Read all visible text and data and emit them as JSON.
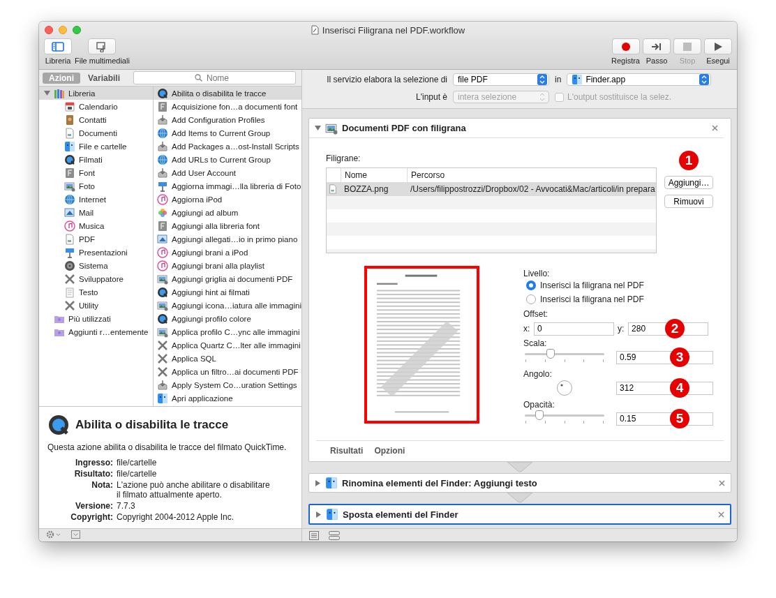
{
  "window": {
    "title": "Inserisci Filigrana nel PDF.workflow"
  },
  "toolbar_left": [
    {
      "label": "Libreria",
      "kind": "library",
      "selected": true
    },
    {
      "label": "File multimediali",
      "kind": "media",
      "selected": false
    }
  ],
  "toolbar_right": [
    {
      "label": "Registra",
      "kind": "record",
      "disabled": false
    },
    {
      "label": "Passo",
      "kind": "step",
      "disabled": false
    },
    {
      "label": "Stop",
      "kind": "stop",
      "disabled": true
    },
    {
      "label": "Esegui",
      "kind": "run",
      "disabled": false
    }
  ],
  "library_tabs": [
    {
      "label": "Azioni",
      "selected": true
    },
    {
      "label": "Variabili",
      "selected": false
    }
  ],
  "search": {
    "placeholder": "Nome"
  },
  "categories": [
    {
      "label": "Libreria",
      "kind": "library",
      "selected": true,
      "expanded": true,
      "children": [
        {
          "label": "Calendario",
          "kind": "calendar",
          "selected": false
        },
        {
          "label": "Contatti",
          "kind": "contacts",
          "selected": false
        },
        {
          "label": "Documenti",
          "kind": "document",
          "selected": false
        },
        {
          "label": "File e cartelle",
          "kind": "finder",
          "selected": false
        },
        {
          "label": "Filmati",
          "kind": "quicktime",
          "selected": false
        },
        {
          "label": "Font",
          "kind": "font",
          "selected": false
        },
        {
          "label": "Foto",
          "kind": "preview",
          "selected": false
        },
        {
          "label": "Internet",
          "kind": "globe",
          "selected": false
        },
        {
          "label": "Mail",
          "kind": "mail",
          "selected": false
        },
        {
          "label": "Musica",
          "kind": "music",
          "selected": false
        },
        {
          "label": "PDF",
          "kind": "document",
          "selected": false
        },
        {
          "label": "Presentazioni",
          "kind": "keynote",
          "selected": false
        },
        {
          "label": "Sistema",
          "kind": "system",
          "selected": false
        },
        {
          "label": "Sviluppatore",
          "kind": "tools",
          "selected": false
        },
        {
          "label": "Testo",
          "kind": "text",
          "selected": false
        },
        {
          "label": "Utility",
          "kind": "tools",
          "selected": false
        }
      ]
    },
    {
      "label": "Più utilizzati",
      "kind": "smartfolder",
      "selected": false
    },
    {
      "label": "Aggiunti r…entemente",
      "kind": "smartfolder",
      "selected": false
    }
  ],
  "actions": [
    {
      "label": "Abilita o disabilita le tracce",
      "kind": "quicktime",
      "selected": true
    },
    {
      "label": "Acquisizione fon…a documenti font",
      "kind": "font",
      "selected": false
    },
    {
      "label": "Add Configuration Profiles",
      "kind": "installer",
      "selected": false
    },
    {
      "label": "Add Items to Current Group",
      "kind": "globe",
      "selected": false
    },
    {
      "label": "Add Packages a…ost-Install Scripts",
      "kind": "installer",
      "selected": false
    },
    {
      "label": "Add URLs to Current Group",
      "kind": "globe",
      "selected": false
    },
    {
      "label": "Add User Account",
      "kind": "installer",
      "selected": false
    },
    {
      "label": "Aggiorna immagi…lla libreria di Foto",
      "kind": "keynote",
      "selected": false
    },
    {
      "label": "Aggiorna iPod",
      "kind": "music",
      "selected": false
    },
    {
      "label": "Aggiungi ad album",
      "kind": "photos",
      "selected": false
    },
    {
      "label": "Aggiungi alla libreria font",
      "kind": "font",
      "selected": false
    },
    {
      "label": "Aggiungi allegati…io in primo piano",
      "kind": "mail",
      "selected": false
    },
    {
      "label": "Aggiungi brani a iPod",
      "kind": "music",
      "selected": false
    },
    {
      "label": "Aggiungi brani alla playlist",
      "kind": "music",
      "selected": false
    },
    {
      "label": "Aggiungi griglia ai documenti PDF",
      "kind": "preview",
      "selected": false
    },
    {
      "label": "Aggiungi hint ai filmati",
      "kind": "quicktime",
      "selected": false
    },
    {
      "label": "Aggiungi icona…iatura alle immagini",
      "kind": "preview",
      "selected": false
    },
    {
      "label": "Aggiungi profilo colore",
      "kind": "quicktime",
      "selected": false
    },
    {
      "label": "Applica profilo C…ync alle immagini",
      "kind": "preview",
      "selected": false
    },
    {
      "label": "Applica Quartz C…lter alle immagini",
      "kind": "tools",
      "selected": false
    },
    {
      "label": "Applica SQL",
      "kind": "tools",
      "selected": false
    },
    {
      "label": "Applica un filtro…ai documenti PDF",
      "kind": "tools",
      "selected": false
    },
    {
      "label": "Apply System Co…uration Settings",
      "kind": "installer",
      "selected": false
    },
    {
      "label": "Apri applicazione",
      "kind": "finder",
      "selected": false
    }
  ],
  "description": {
    "title": "Abilita o disabilita le tracce",
    "kind": "quicktime",
    "text": "Questa azione abilita o disabilita le tracce del filmato QuickTime.",
    "details": [
      {
        "label": "Ingresso:",
        "value": "file/cartelle"
      },
      {
        "label": "Risultato:",
        "value": "file/cartelle"
      },
      {
        "label": "Nota:",
        "value": "L'azione può anche abilitare o disabilitare il filmato attualmente aperto."
      },
      {
        "label": "Versione:",
        "value": "7.7.3"
      },
      {
        "label": "Copyright:",
        "value": "Copyright 2004-2012 Apple Inc."
      }
    ]
  },
  "service": {
    "label": "Il servizio elabora la selezione di",
    "type": "file PDF",
    "in_label": "in",
    "app": "Finder.app",
    "input_label": "L'input è",
    "input_value": "intera selezione",
    "input_disabled": true,
    "output": {
      "label": "L'output sostituisce la selez.",
      "checked": false,
      "disabled": true
    }
  },
  "workflow": [
    {
      "title": "Documenti PDF con filigrana",
      "kind": "preview",
      "expanded": true,
      "selected": false,
      "content": {
        "list_label": "Filigrane:",
        "columns": [
          "Nome",
          "Percorso"
        ],
        "rows": [
          {
            "name": "BOZZA.png",
            "path": "/Users/filippostrozzi/Dropbox/02 - Avvocati&Mac/articoli/in prepara",
            "selected": true
          }
        ],
        "buttons": [
          "Aggiungi…",
          "Rimuovi"
        ],
        "callout": "1",
        "preview": {
          "kind": "picture"
        },
        "level_label": "Livello:",
        "level_options": [
          {
            "label": "Inserisci la filigrana nel PDF",
            "selected": true
          },
          {
            "label": "Inserisci la filigrana nel PDF",
            "selected": false
          }
        ],
        "offset": {
          "label": "Offset:",
          "x_label": "x:",
          "x_value": "0",
          "y_label": "y:",
          "y_value": "280",
          "callout": "2"
        },
        "scale": {
          "label": "Scala:",
          "level": 0.32,
          "value": "0.59",
          "callout": "3"
        },
        "angle": {
          "label": "Angolo:",
          "value": "312",
          "callout": "4"
        },
        "opacity": {
          "label": "Opacità:",
          "level": 0.18,
          "value": "0.15",
          "callout": "5"
        },
        "tabs": [
          "Risultati",
          "Opzioni"
        ]
      }
    },
    {
      "title": "Rinomina elementi del Finder: Aggiungi testo",
      "kind": "finder",
      "expanded": false,
      "selected": false
    },
    {
      "title": "Sposta elementi del Finder",
      "kind": "finder",
      "expanded": false,
      "selected": true
    }
  ]
}
